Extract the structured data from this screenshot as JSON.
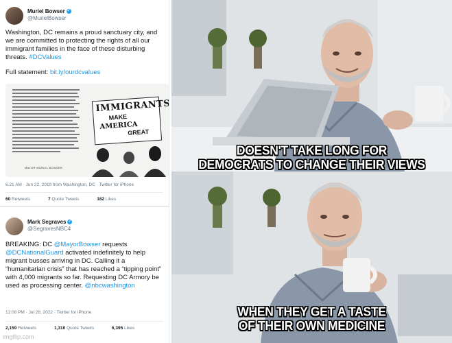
{
  "tweet1": {
    "name": "Muriel Bowser",
    "handle": "@MurielBowser",
    "text": "Washington, DC remains a proud sanctuary city, and we are committed to protecting the rights of all our immigrant families in the face of these disturbing threats.",
    "hashtag": "#DCValues",
    "statement_label": "Full statement:",
    "statement_link": "bit.ly/ourdcvalues",
    "poster": {
      "sign_line1": "IMMIGRANTS",
      "sign_line2": "MAKE",
      "sign_line3": "AMERICA",
      "sign_line4": "GREAT",
      "caption": "MAYOR MURIEL BOWSER"
    },
    "meta": "6:21 AM · Jun 22, 2019 from Washington, DC · Twitter for iPhone",
    "retweets": "60",
    "retweets_label": "Retweets",
    "quotes": "7",
    "quotes_label": "Quote Tweets",
    "likes": "182",
    "likes_label": "Likes"
  },
  "tweet2": {
    "name": "Mark Segraves",
    "handle": "@SegravesNBC4",
    "text_a": "BREAKING: DC ",
    "mention1": "@MayorBowser",
    "text_b": " requests ",
    "mention2": "@DCNationalGuard",
    "text_c": " activated indefinitely to help migrant busses arriving in DC. Calling it a “humanitarian crisis” that has reached a “tipping point” with 4,000 migrants so far. Requesting DC Armory be used as processing center. ",
    "mention3": "@nbcwashington",
    "meta": "12:08 PM · Jul 28, 2022 · Twitter for iPhone",
    "retweets": "2,159",
    "retweets_label": "Retweets",
    "quotes": "1,310",
    "quotes_label": "Quote Tweets",
    "likes": "6,395",
    "likes_label": "Likes"
  },
  "meme": {
    "caption_top_line1": "DOESN'T TAKE LONG FOR",
    "caption_top_line2": "DEMOCRATS TO CHANGE THEIR VIEWS",
    "caption_bottom_line1": "WHEN THEY GET A TASTE",
    "caption_bottom_line2": "OF THEIR OWN MEDICINE",
    "watermark": "imgflip.com"
  },
  "colors": {
    "link": "#1b95e0",
    "caption_fill": "#ffffff",
    "caption_outline": "#000000"
  },
  "icons": [
    "verified-badge-icon"
  ]
}
